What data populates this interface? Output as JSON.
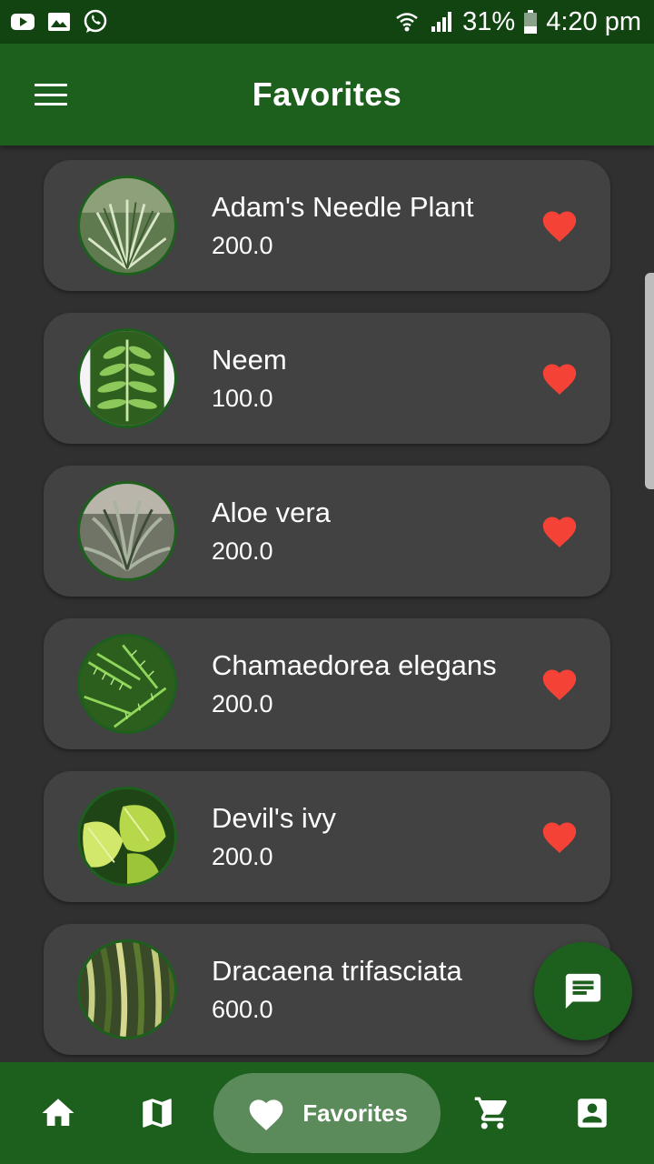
{
  "status_bar": {
    "battery": "31%",
    "time": "4:20 pm",
    "icons": [
      "youtube-icon",
      "gallery-icon",
      "whatsapp-icon",
      "wifi-icon",
      "signal-icon",
      "battery-icon"
    ]
  },
  "app_bar": {
    "title": "Favorites",
    "menu_icon": "hamburger-menu-icon"
  },
  "favorites": [
    {
      "name": "Adam's Needle Plant",
      "price": "200.0",
      "favorited": true
    },
    {
      "name": "Neem",
      "price": "100.0",
      "favorited": true
    },
    {
      "name": "Aloe vera",
      "price": "200.0",
      "favorited": true
    },
    {
      "name": "Chamaedorea elegans",
      "price": "200.0",
      "favorited": true
    },
    {
      "name": "Devil's ivy",
      "price": "200.0",
      "favorited": true
    },
    {
      "name": "Dracaena trifasciata",
      "price": "600.0",
      "favorited": true
    }
  ],
  "fab": {
    "icon": "chat-icon"
  },
  "bottom_nav": {
    "items": [
      {
        "icon": "home-icon"
      },
      {
        "icon": "map-icon"
      },
      {
        "icon": "heart-icon",
        "label": "Favorites",
        "active": true
      },
      {
        "icon": "cart-icon"
      },
      {
        "icon": "account-icon"
      }
    ]
  },
  "colors": {
    "status_bar": "#124412",
    "primary": "#1d5f1d",
    "background": "#303030",
    "card": "#424242",
    "heart": "#f44336",
    "nav_active_pill": "#5b8b5b"
  }
}
